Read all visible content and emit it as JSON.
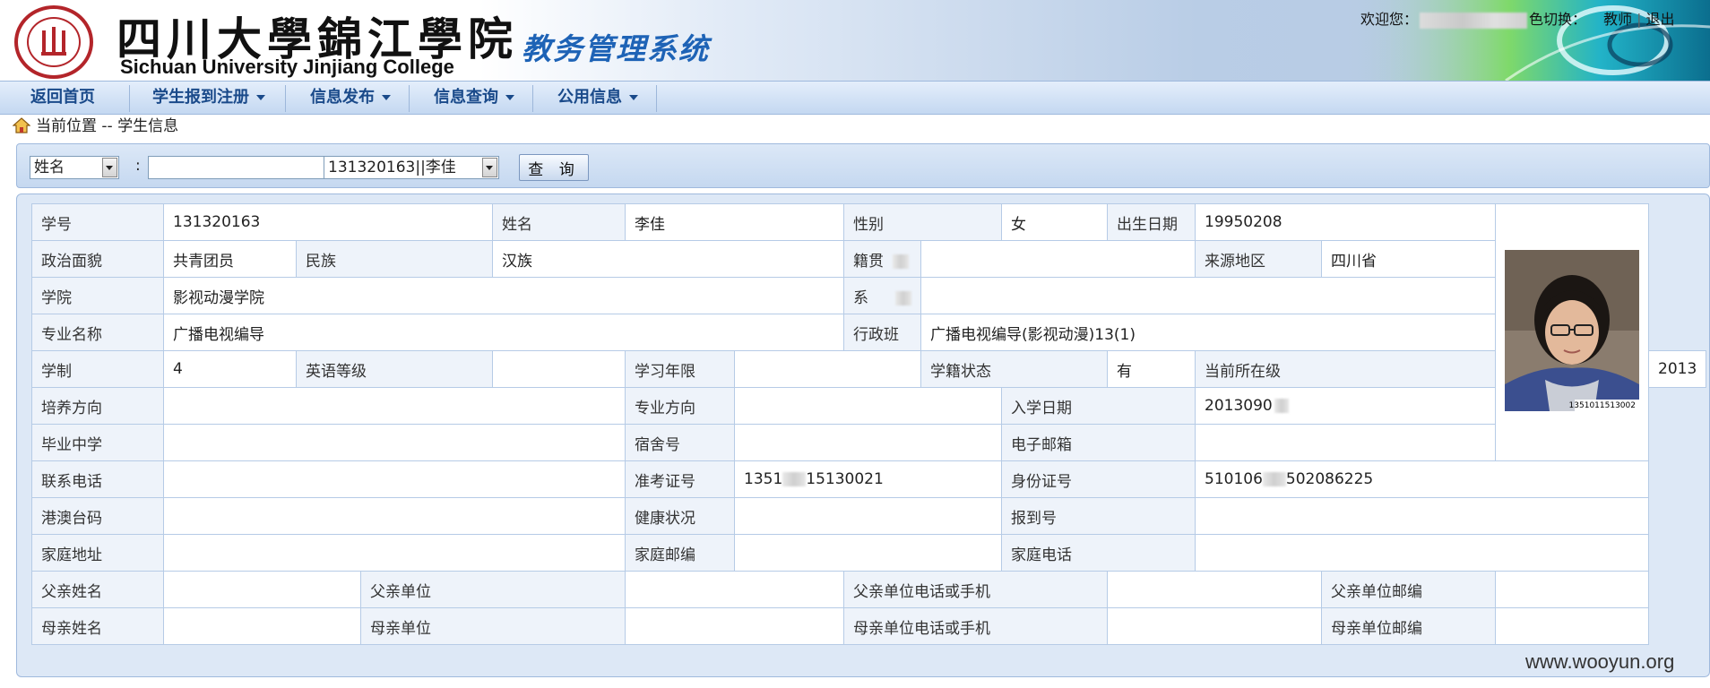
{
  "header": {
    "school_name_cn": "四川大學錦江學院",
    "school_name_en": "Sichuan University Jinjiang College",
    "system_title": "教务管理系统",
    "welcome_label": "欢迎您：",
    "theme_switch_label": "色切换：",
    "role_label": "教师",
    "logout_label": "退出"
  },
  "nav": {
    "items": [
      {
        "label": "返回首页",
        "has_dropdown": false
      },
      {
        "label": "学生报到注册",
        "has_dropdown": true
      },
      {
        "label": "信息发布",
        "has_dropdown": true
      },
      {
        "label": "信息查询",
        "has_dropdown": true
      },
      {
        "label": "公用信息",
        "has_dropdown": true
      }
    ]
  },
  "breadcrumb": {
    "text": "当前位置 -- 学生信息"
  },
  "search": {
    "field_select": "姓名",
    "colon": ":",
    "input_value": "",
    "result_select": "131320163||李佳",
    "query_button": "查  询"
  },
  "student": {
    "student_id_label": "学号",
    "student_id": "131320163",
    "name_label": "姓名",
    "name": "李佳",
    "gender_label": "性别",
    "gender": "女",
    "birth_label": "出生日期",
    "birth": "19950208",
    "political_label": "政治面貌",
    "political": "共青团员",
    "ethnic_label": "民族",
    "ethnic": "汉族",
    "native_label": "籍贯",
    "native": "",
    "origin_label": "来源地区",
    "origin": "四川省",
    "college_label": "学院",
    "college": "影视动漫学院",
    "dept_label": "系",
    "dept": "",
    "major_label": "专业名称",
    "major": "广播电视编导",
    "class_label": "行政班",
    "class_name": "广播电视编导(影视动漫)13(1)",
    "length_label": "学制",
    "length": "4",
    "english_label": "英语等级",
    "english": "",
    "study_years_label": "学习年限",
    "study_years": "",
    "status_label": "学籍状态",
    "status": "有",
    "grade_label": "当前所在级",
    "grade": "2013",
    "training_label": "培养方向",
    "training": "",
    "major_dir_label": "专业方向",
    "major_dir": "",
    "enroll_label": "入学日期",
    "enroll": "2013090",
    "highschool_label": "毕业中学",
    "highschool": "",
    "dorm_label": "宿舍号",
    "dorm": "",
    "email_label": "电子邮箱",
    "email": "",
    "phone_label": "联系电话",
    "phone": "",
    "exam_label": "准考证号",
    "exam_prefix": "1351",
    "exam_suffix": "15130021",
    "idcard_label": "身份证号",
    "idcard_prefix": "510106",
    "idcard_suffix": "502086225",
    "hkmt_label": "港澳台码",
    "hkmt": "",
    "health_label": "健康状况",
    "health": "",
    "report_label": "报到号",
    "report": "",
    "address_label": "家庭地址",
    "address": "",
    "zip_label": "家庭邮编",
    "zip": "",
    "homephone_label": "家庭电话",
    "homephone": "",
    "father_name_label": "父亲姓名",
    "father_name": "",
    "father_work_label": "父亲单位",
    "father_work": "",
    "father_phone_label": "父亲单位电话或手机",
    "father_phone": "",
    "father_zip_label": "父亲单位邮编",
    "father_zip": "",
    "mother_name_label": "母亲姓名",
    "mother_name": "",
    "mother_work_label": "母亲单位",
    "mother_work": "",
    "mother_phone_label": "母亲单位电话或手机",
    "mother_phone": "",
    "mother_zip_label": "母亲单位邮编",
    "mother_zip": "",
    "photo_caption": "1351011513002"
  },
  "watermark": "www.wooyun.org"
}
